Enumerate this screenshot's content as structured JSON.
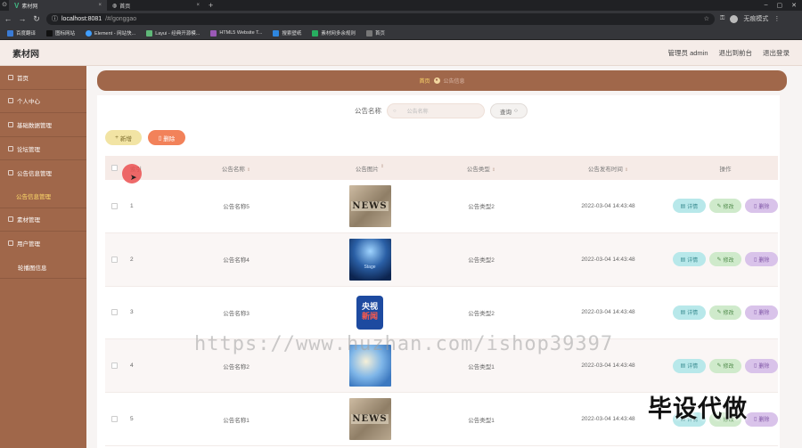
{
  "browser": {
    "tabs": [
      {
        "title": "素材网",
        "active": true
      },
      {
        "title": "首页",
        "active": false
      }
    ],
    "url_host": "localhost:8081",
    "url_path": "/#/gonggao",
    "profile_label": "无痕模式",
    "bookmarks": [
      {
        "label": "百度翻译",
        "color": "#3a7bd5"
      },
      {
        "label": "图标网站",
        "color": "#222222"
      },
      {
        "label": "Element - 网站快...",
        "color": "#409eff"
      },
      {
        "label": "Layui - 经典开源模...",
        "color": "#5fb878"
      },
      {
        "label": "HTML5 Website T...",
        "color": "#9b59b6"
      },
      {
        "label": "搜索壁纸",
        "color": "#2e86de"
      },
      {
        "label": "素材网多余规则",
        "color": "#27ae60"
      },
      {
        "label": "首页",
        "color": "#555555"
      }
    ]
  },
  "header": {
    "title": "素材网",
    "user_label": "管理员 admin",
    "back_label": "退出到前台",
    "logout_label": "退出登录"
  },
  "sidebar": {
    "items": [
      {
        "label": "首页",
        "type": "main"
      },
      {
        "label": "个人中心",
        "type": "main"
      },
      {
        "label": "基础数据管理",
        "type": "main"
      },
      {
        "label": "论坛管理",
        "type": "main"
      },
      {
        "label": "公告信息管理",
        "type": "main"
      },
      {
        "label": "公告信息管理",
        "type": "sub"
      },
      {
        "label": "素材管理",
        "type": "main"
      },
      {
        "label": "用户管理",
        "type": "main"
      },
      {
        "label": "轮播图信息",
        "type": "sub2"
      }
    ]
  },
  "breadcrumb": {
    "home": "首页",
    "current": "公告信息"
  },
  "search": {
    "label": "公告名称",
    "placeholder": "公告名称",
    "button": "查询"
  },
  "actions": {
    "add": "新增",
    "delete": "删除"
  },
  "table": {
    "headers": {
      "index": "索引",
      "name": "公告名称",
      "image": "公告图片",
      "type": "公告类型",
      "time": "公告发布时间",
      "ops": "操作"
    },
    "ops": {
      "detail": "详情",
      "edit": "修改",
      "delete": "删除"
    },
    "rows": [
      {
        "index": "1",
        "name": "公告名称5",
        "image": "news",
        "type": "公告类型2",
        "time": "2022-03-04 14:43:48"
      },
      {
        "index": "2",
        "name": "公告名称4",
        "image": "stage",
        "type": "公告类型2",
        "time": "2022-03-04 14:43:48"
      },
      {
        "index": "3",
        "name": "公告名称3",
        "image": "cctv",
        "type": "公告类型2",
        "time": "2022-03-04 14:43:48"
      },
      {
        "index": "4",
        "name": "公告名称2",
        "image": "globe",
        "type": "公告类型1",
        "time": "2022-03-04 14:43:48"
      },
      {
        "index": "5",
        "name": "公告名称1",
        "image": "news",
        "type": "公告类型1",
        "time": "2022-03-04 14:43:48"
      }
    ]
  },
  "images": {
    "news_text": "NEWS",
    "stage_text": "Stage",
    "cctv_top": "央视",
    "cctv_bottom": "新闻"
  },
  "overlay": {
    "watermark": "https://www.huzhan.com/ishop39397",
    "stamp": "毕设代做"
  },
  "colors": {
    "sidebar": "#a0674a",
    "header": "#f5ece8",
    "accent_yellow": "#ffdc6b",
    "delete_orange": "#f2825a"
  }
}
